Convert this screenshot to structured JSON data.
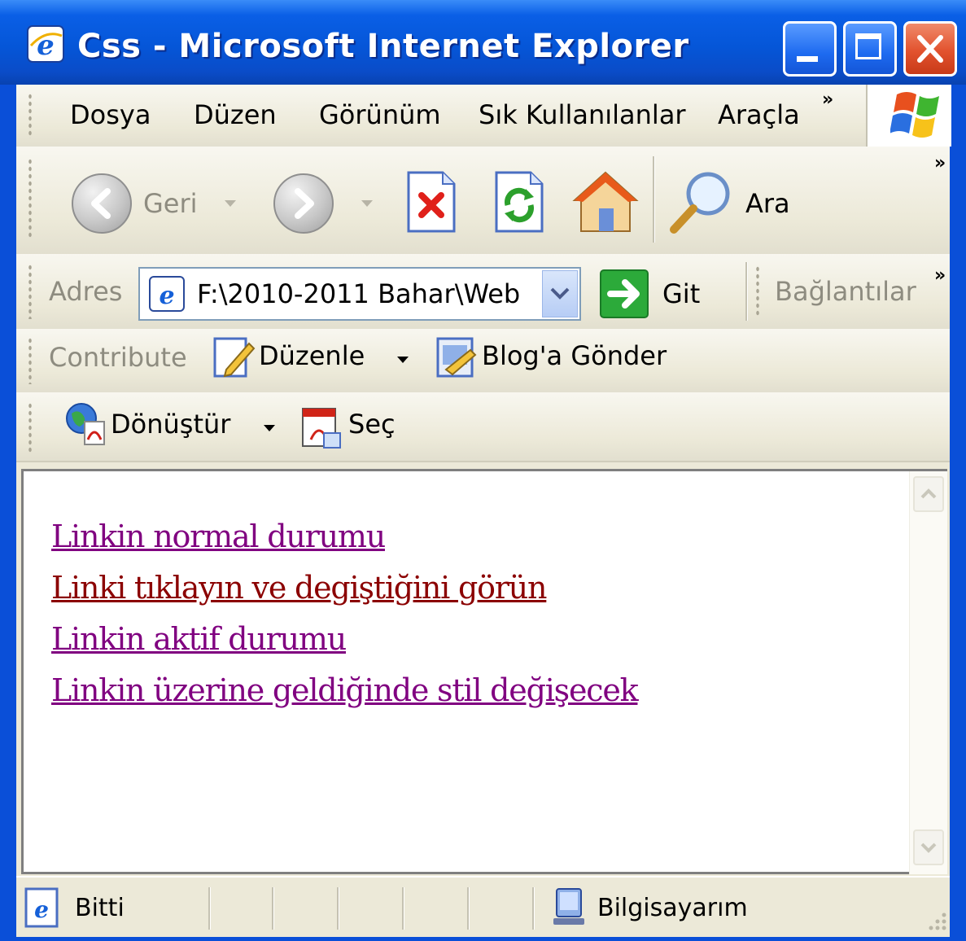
{
  "window": {
    "title": "Css - Microsoft Internet Explorer"
  },
  "menu": {
    "items": [
      "Dosya",
      "Düzen",
      "Görünüm",
      "Sık Kullanılanlar",
      "Araçla"
    ],
    "more": "»"
  },
  "toolbar": {
    "back_label": "Geri",
    "search_label": "Ara",
    "more": "»"
  },
  "address_bar": {
    "label": "Adres",
    "value": "F:\\2010-2011 Bahar\\Web",
    "go_label": "Git",
    "links_label": "Bağlantılar",
    "more": "»"
  },
  "contribute_bar": {
    "label": "Contribute",
    "edit_label": "Düzenle",
    "blog_label": "Blog'a Gönder"
  },
  "pdf_bar": {
    "convert_label": "Dönüştür",
    "select_label": "Seç"
  },
  "page": {
    "links": [
      {
        "text": "Linkin normal durumu",
        "color": "#800080"
      },
      {
        "text": "Linki tıklayın ve degiştiğini görün",
        "color": "#8b0000"
      },
      {
        "text": "Linkin aktif durumu",
        "color": "#800080"
      },
      {
        "text": "Linkin üzerine geldiğinde stil değişecek",
        "color": "#800080"
      }
    ]
  },
  "status": {
    "text": "Bitti",
    "zone": "Bilgisayarım"
  },
  "colors": {
    "titlebar": "#0a5fe6",
    "chrome": "#ece9d8",
    "visited_link": "#800080",
    "hover_link": "#8b0000"
  }
}
